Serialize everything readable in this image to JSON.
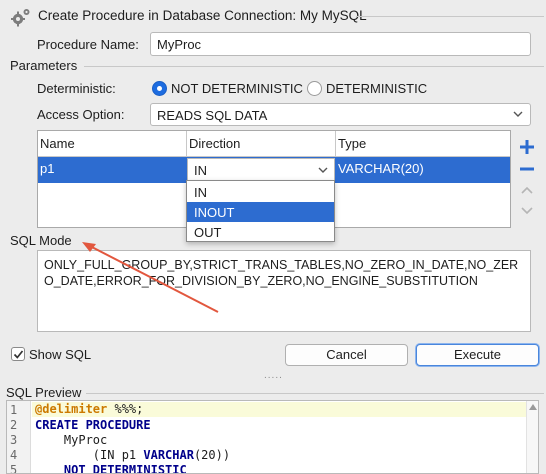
{
  "window": {
    "title": "Create Procedure in Database Connection: My MySQL"
  },
  "procedure": {
    "name_label": "Procedure Name:",
    "name_value": "MyProc"
  },
  "parameters": {
    "section_label": "Parameters",
    "deterministic_label": "Deterministic:",
    "radio_not_deterministic": "NOT DETERMINISTIC",
    "radio_deterministic": "DETERMINISTIC",
    "selected_deterministic": "NOT DETERMINISTIC",
    "access_option_label": "Access Option:",
    "access_option_value": "READS SQL DATA",
    "table": {
      "columns": [
        "Name",
        "Direction",
        "Type"
      ],
      "rows": [
        {
          "name": "p1",
          "direction": "IN",
          "type": "VARCHAR(20)"
        }
      ]
    },
    "direction_dropdown": {
      "options": [
        "IN",
        "INOUT",
        "OUT"
      ],
      "highlighted": "INOUT"
    }
  },
  "sql_mode": {
    "label": "SQL Mode",
    "value": "ONLY_FULL_GROUP_BY,STRICT_TRANS_TABLES,NO_ZERO_IN_DATE,NO_ZERO_DATE,ERROR_FOR_DIVISION_BY_ZERO,NO_ENGINE_SUBSTITUTION"
  },
  "footer": {
    "show_sql_label": "Show SQL",
    "show_sql_checked": true,
    "cancel_label": "Cancel",
    "execute_label": "Execute",
    "grip": "....."
  },
  "preview": {
    "label": "SQL Preview",
    "line_numbers": [
      "1",
      "2",
      "3",
      "4",
      "5"
    ],
    "lines": [
      {
        "kw": "",
        "text": "@delimiter %%%;",
        "at": "@delimiter",
        "rest": " %%%;"
      },
      {
        "text": "CREATE PROCEDURE"
      },
      {
        "text": "    MyProc"
      },
      {
        "pre": "        (IN p1 ",
        "kw": "VARCHAR",
        "post": "(20))"
      },
      {
        "text": "    NOT DETERMINISTIC"
      }
    ]
  },
  "colors": {
    "accent": "#2d6cd0",
    "arrow": "#e2573e"
  },
  "icons": [
    "gear-icon",
    "add-icon",
    "remove-icon",
    "move-up-icon",
    "move-down-icon",
    "chevron-down-icon",
    "checkmark-icon"
  ]
}
